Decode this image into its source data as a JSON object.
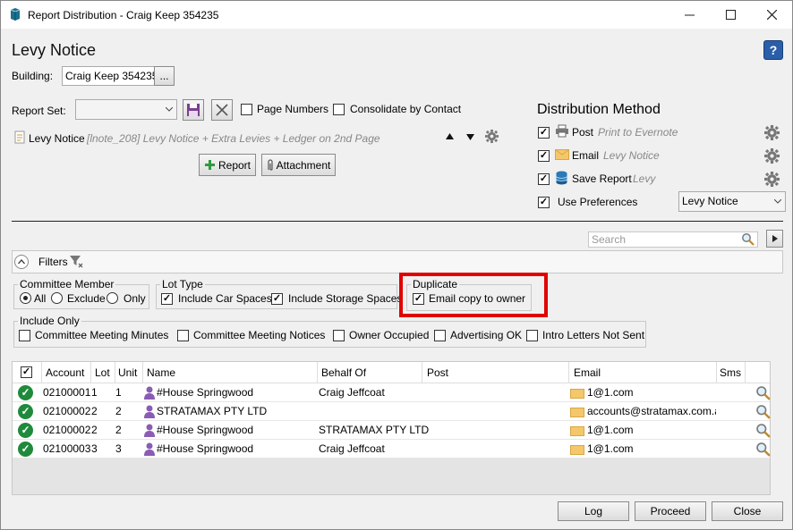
{
  "window": {
    "title": "Report Distribution - Craig Keep 354235"
  },
  "page_title": "Levy Notice",
  "building": {
    "label": "Building:",
    "value": "Craig Keep 354235",
    "browse": "..."
  },
  "report_set": {
    "label": "Report Set:",
    "value": "",
    "page_numbers": "Page Numbers",
    "consolidate": "Consolidate by Contact"
  },
  "report_item": {
    "name": "Levy Notice",
    "detail": "[lnote_208] Levy Notice + Extra Levies + Ledger on 2nd Page"
  },
  "buttons": {
    "report": "Report",
    "attachment": "Attachment",
    "log": "Log",
    "proceed": "Proceed",
    "close": "Close"
  },
  "distribution": {
    "title": "Distribution Method",
    "post": {
      "label": "Post",
      "detail": "Print to Evernote",
      "checked": true
    },
    "email": {
      "label": "Email",
      "detail": "Levy Notice",
      "checked": true
    },
    "save": {
      "label": "Save Report",
      "detail": "Levy",
      "checked": true
    },
    "prefs": {
      "label": "Use Preferences",
      "checked": true,
      "selected": "Levy Notice"
    }
  },
  "search": {
    "placeholder": "Search"
  },
  "filters": {
    "label": "Filters",
    "committee": {
      "title": "Committee Member",
      "all": "All",
      "exclude": "Exclude",
      "only": "Only",
      "selected": "All"
    },
    "lot_type": {
      "title": "Lot Type",
      "car": "Include Car Spaces",
      "storage": "Include Storage Spaces"
    },
    "duplicate": {
      "title": "Duplicate",
      "email_copy": "Email copy to owner"
    },
    "include_only": {
      "title": "Include Only",
      "minutes": "Committee Meeting Minutes",
      "notices": "Committee Meeting Notices",
      "owner_occupied": "Owner Occupied",
      "advertising": "Advertising OK",
      "intro": "Intro Letters Not Sent"
    }
  },
  "table": {
    "columns": [
      "Account",
      "Lot",
      "Unit",
      "Name",
      "Behalf Of",
      "Post",
      "Email",
      "Sms"
    ],
    "rows": [
      {
        "account": "02100001",
        "lot": "1",
        "unit": "1",
        "name": "#House Springwood",
        "behalf": "Craig Jeffcoat",
        "post": "",
        "email": "1@1.com"
      },
      {
        "account": "02100002",
        "lot": "2",
        "unit": "2",
        "name": "STRATAMAX PTY LTD",
        "behalf": "",
        "post": "",
        "email": "accounts@stratamax.com.a"
      },
      {
        "account": "02100002",
        "lot": "2",
        "unit": "2",
        "name": "#House Springwood",
        "behalf": "STRATAMAX PTY LTD",
        "post": "",
        "email": "1@1.com"
      },
      {
        "account": "02100003",
        "lot": "3",
        "unit": "3",
        "name": "#House Springwood",
        "behalf": "Craig Jeffcoat",
        "post": "",
        "email": "1@1.com"
      }
    ]
  },
  "colors": {
    "highlight": "#e00000",
    "ok_green": "#1f8a3c",
    "person_purple": "#8a5cb5"
  }
}
